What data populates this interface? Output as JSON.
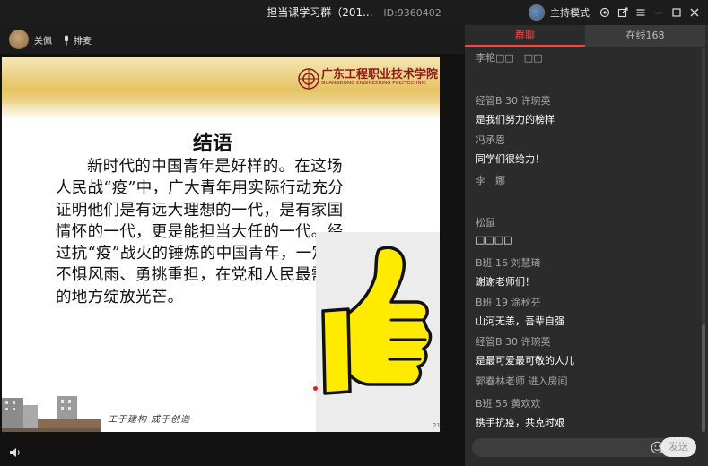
{
  "window": {
    "title": "担当课学习群（201...",
    "room_id": "ID:9360402",
    "host_mode": "主持模式"
  },
  "toolbar": {
    "presenter_name": "关佩",
    "mic_label": "排麦"
  },
  "slide": {
    "school_cn": "广东工程职业技术学院",
    "school_en": "GUANGDONG ENGINEERING POLYTECHNIC",
    "title": "结语",
    "body": "新时代的中国青年是好样的。在这场人民战“疫”中，广大青年用实际行动充分证明他们是有远大理想的一代，是有家国情怀的一代，更是能担当大任的一代。经过抗“疫”战火的锤炼的中国青年，一定能不惧风雨、勇挑重担，在党和人民最需要的地方绽放光芒。",
    "motto": "工于建构 成于创造",
    "page_number": "21"
  },
  "chat": {
    "tabs": [
      {
        "label": "群聊",
        "active": true
      },
      {
        "label": "在线168",
        "active": false
      }
    ],
    "messages": [
      {
        "name": "李艳□□　□□",
        "text": ""
      },
      {
        "name": "经管B 30 许琬英",
        "text": "是我们努力的榜样"
      },
      {
        "name": "冯承恩",
        "text": "同学们很给力！"
      },
      {
        "name": "李　娜",
        "text": ""
      },
      {
        "name": "松鼠",
        "text": "□□□□"
      },
      {
        "name": "B班 16 刘慧琦",
        "text": "谢谢老师们！"
      },
      {
        "name": "B班 19 涂秋芬",
        "text": "山河无恙，吾辈自强"
      },
      {
        "name": "经管B 30 许琬英",
        "text": "是最可爱最可敬的人儿"
      },
      {
        "name": "",
        "text": ""
      },
      {
        "name": "B班 55 黄欢欢",
        "text": "携手抗疫，共克时艰"
      }
    ],
    "system_notice": "郭春林老师 进入房间",
    "input_placeholder": "",
    "send_label": "发送"
  },
  "colors": {
    "accent": "#e84a4a",
    "panel_bg": "#2b2b2b",
    "thumb_yellow": "#ffeb00"
  }
}
